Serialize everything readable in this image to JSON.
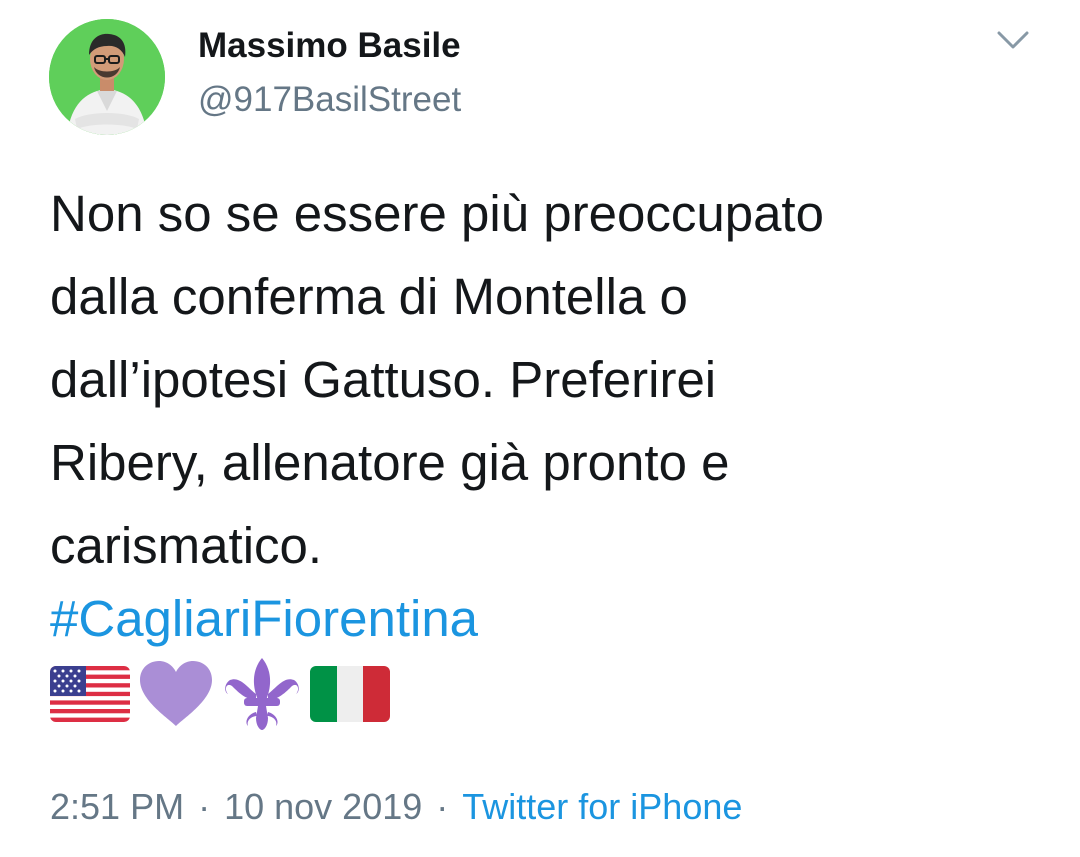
{
  "tweet": {
    "author": {
      "name": "Massimo Basile",
      "handle": "@917BasilStreet"
    },
    "text_lines": [
      "Non so se essere più preoccupato",
      "dalla conferma di Montella o",
      "dall’ipotesi Gattuso. Preferirei",
      "Ribery, allenatore già pronto e",
      "carismatico."
    ],
    "hashtag": "#CagliariFiorentina",
    "emojis": [
      "flag-us-icon",
      "purple-heart-icon",
      "fleur-de-lis-icon",
      "flag-it-icon"
    ],
    "time": "2:51 PM",
    "separator": "·",
    "date": "10 nov 2019",
    "source": "Twitter for iPhone",
    "menu_icon": "chevron-down-icon"
  },
  "colors": {
    "text": "#14171a",
    "secondary": "#657786",
    "link": "#1b95e0",
    "purple": "#aa8ed6",
    "avatar_bg": "#5fcf5a"
  }
}
